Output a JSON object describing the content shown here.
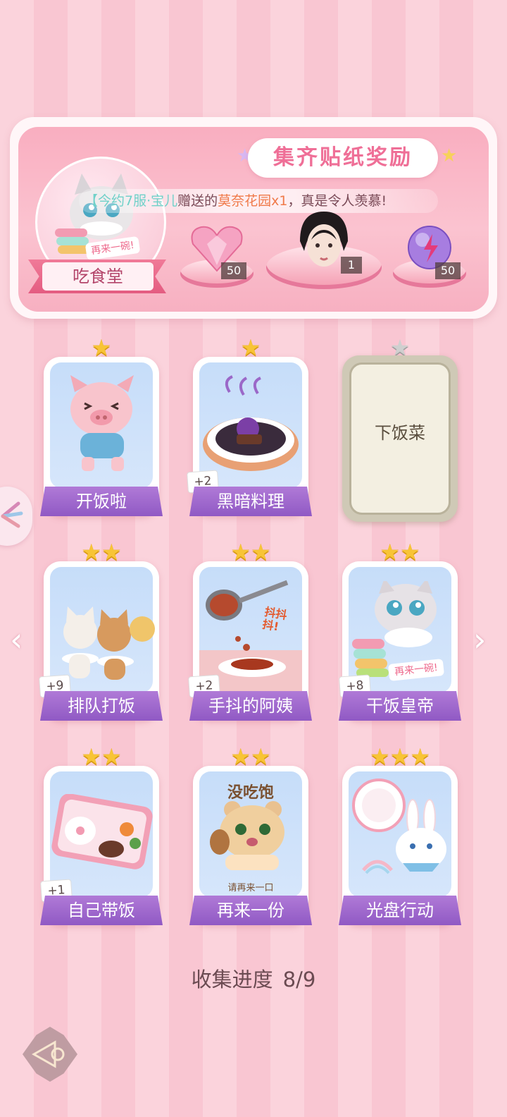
{
  "reward_panel": {
    "title": "集齐贴纸奖励",
    "collection_name": "吃食堂",
    "announcement": {
      "user": "【今约7服·宝儿",
      "verb": "赠送的",
      "gift": "莫奈花园x1",
      "tail": "，真是令人羡慕!"
    },
    "rewards": [
      {
        "name": "pink-heart-gem-icon",
        "count": "50"
      },
      {
        "name": "portrait-avatar-icon",
        "count": "1"
      },
      {
        "name": "purple-energy-orb-icon",
        "count": "50"
      }
    ],
    "badge_sticker_text": "再来一碗!"
  },
  "cards": [
    {
      "label": "开饭啦",
      "stars": 1,
      "plus": "",
      "locked": false
    },
    {
      "label": "黑暗料理",
      "stars": 1,
      "plus": "+2",
      "locked": false
    },
    {
      "label": "下饭菜",
      "stars": 1,
      "plus": "",
      "locked": true
    },
    {
      "label": "排队打饭",
      "stars": 2,
      "plus": "+9",
      "locked": false
    },
    {
      "label": "手抖的阿姨",
      "stars": 2,
      "plus": "+2",
      "locked": false,
      "art_text": "抖抖抖!"
    },
    {
      "label": "干饭皇帝",
      "stars": 2,
      "plus": "+8",
      "locked": false,
      "art_text": "再来一碗!"
    },
    {
      "label": "自己带饭",
      "stars": 2,
      "plus": "+1",
      "locked": false
    },
    {
      "label": "再来一份",
      "stars": 2,
      "plus": "",
      "locked": false,
      "art_text": "没吃饱",
      "art_subtext": "请再来一口"
    },
    {
      "label": "光盘行动",
      "stars": 3,
      "plus": "",
      "locked": false
    }
  ],
  "progress": {
    "label": "收集进度",
    "value": "8/9"
  },
  "nav": {
    "prev": "‹",
    "next": "›"
  },
  "colors": {
    "accent": "#ef6f97",
    "label_purple": "#9c63cc",
    "gold_star": "#f8c436"
  }
}
